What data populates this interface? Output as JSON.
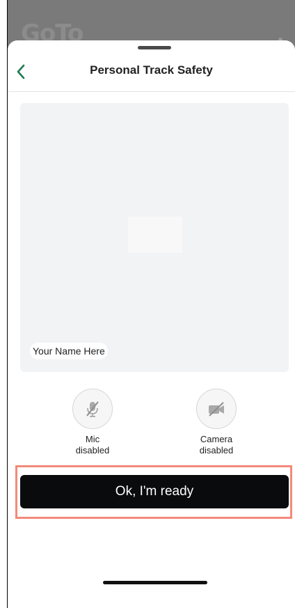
{
  "backdrop": {
    "logo_text": "GoTo"
  },
  "header": {
    "title": "Personal Track Safety",
    "back_icon": "chevron-left-icon",
    "accent": "#1e7a4f"
  },
  "preview": {
    "name_label": "Your Name Here"
  },
  "controls": {
    "mic": {
      "label": "Mic\ndisabled",
      "icon": "mic-off-icon"
    },
    "camera": {
      "label": "Camera\ndisabled",
      "icon": "camera-off-icon"
    }
  },
  "actions": {
    "ready_label": "Ok, I'm ready",
    "highlight_color": "#f28b79"
  }
}
